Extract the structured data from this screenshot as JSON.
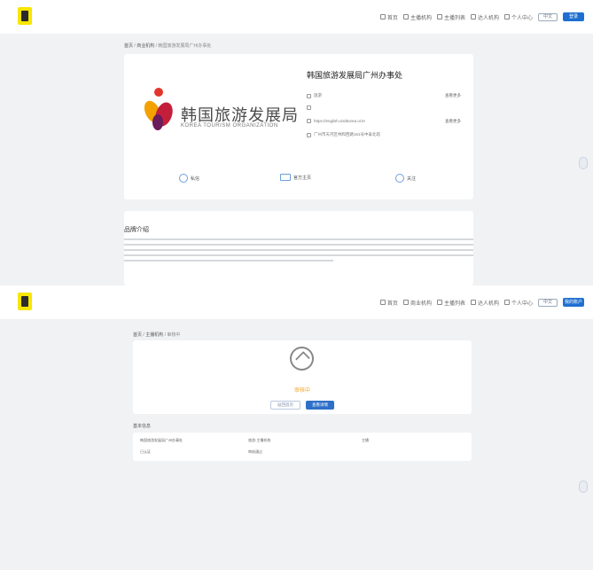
{
  "panel1": {
    "nav": {
      "items": [
        {
          "icon": "home-icon",
          "label": "首页"
        },
        {
          "icon": "users-icon",
          "label": "主播机构"
        },
        {
          "icon": "user-icon",
          "label": "主播列表"
        },
        {
          "icon": "grid-icon",
          "label": "达人机构"
        },
        {
          "icon": "person-icon",
          "label": "个人中心"
        }
      ],
      "lang": "中文",
      "login": "登录"
    },
    "breadcrumb": {
      "home": "首页",
      "section": "商业机构",
      "current": "韩国旅游发展局广州办事处"
    },
    "org": {
      "logo_cn": "韩国旅游发展局",
      "logo_en": "KOREA TOURISM ORGANIZATION",
      "name": "韩国旅游发展局广州办事处",
      "rows": [
        {
          "icon": "tag-icon",
          "text": "旅游",
          "link": "查看更多"
        },
        {
          "icon": "phone-icon",
          "text": "",
          "link": ""
        },
        {
          "icon": "link-icon",
          "text": "https://english.visitkorea.or.kr",
          "link": "查看更多"
        },
        {
          "icon": "location-icon",
          "text": "广州市天河区林和西路161号中泰北塔"
        }
      ],
      "actions": [
        {
          "icon": "chat-icon",
          "label": "私信"
        },
        {
          "icon": "monitor-icon",
          "label": "官方主页"
        },
        {
          "icon": "plus-circle-icon",
          "label": "关注"
        }
      ]
    },
    "intro": {
      "title": "品牌介绍",
      "lines": 7
    }
  },
  "panel2": {
    "nav": {
      "items": [
        {
          "icon": "home-icon",
          "label": "首页"
        },
        {
          "icon": "users-icon",
          "label": "商业机构"
        },
        {
          "icon": "user-icon",
          "label": "主播列表"
        },
        {
          "icon": "grid-icon",
          "label": "达人机构"
        },
        {
          "icon": "person-icon",
          "label": "个人中心"
        }
      ],
      "lang": "中文",
      "login": "我的账户"
    },
    "breadcrumb": {
      "home": "首页",
      "section": "主播机构",
      "current": "审核中"
    },
    "approval": {
      "status": "审核中",
      "secondary_btn": "返回首页",
      "primary_btn": "查看详情"
    },
    "basic_info": {
      "label": "基本信息",
      "cells": [
        "韩国旅游发展局广州办事处",
        "旅游·主播机构",
        "主播",
        "已认证",
        "审核通过"
      ]
    }
  },
  "colors": {
    "primary": "#1f6fd1",
    "warning": "#f5a623",
    "logo_yellow": "#f7e600"
  }
}
